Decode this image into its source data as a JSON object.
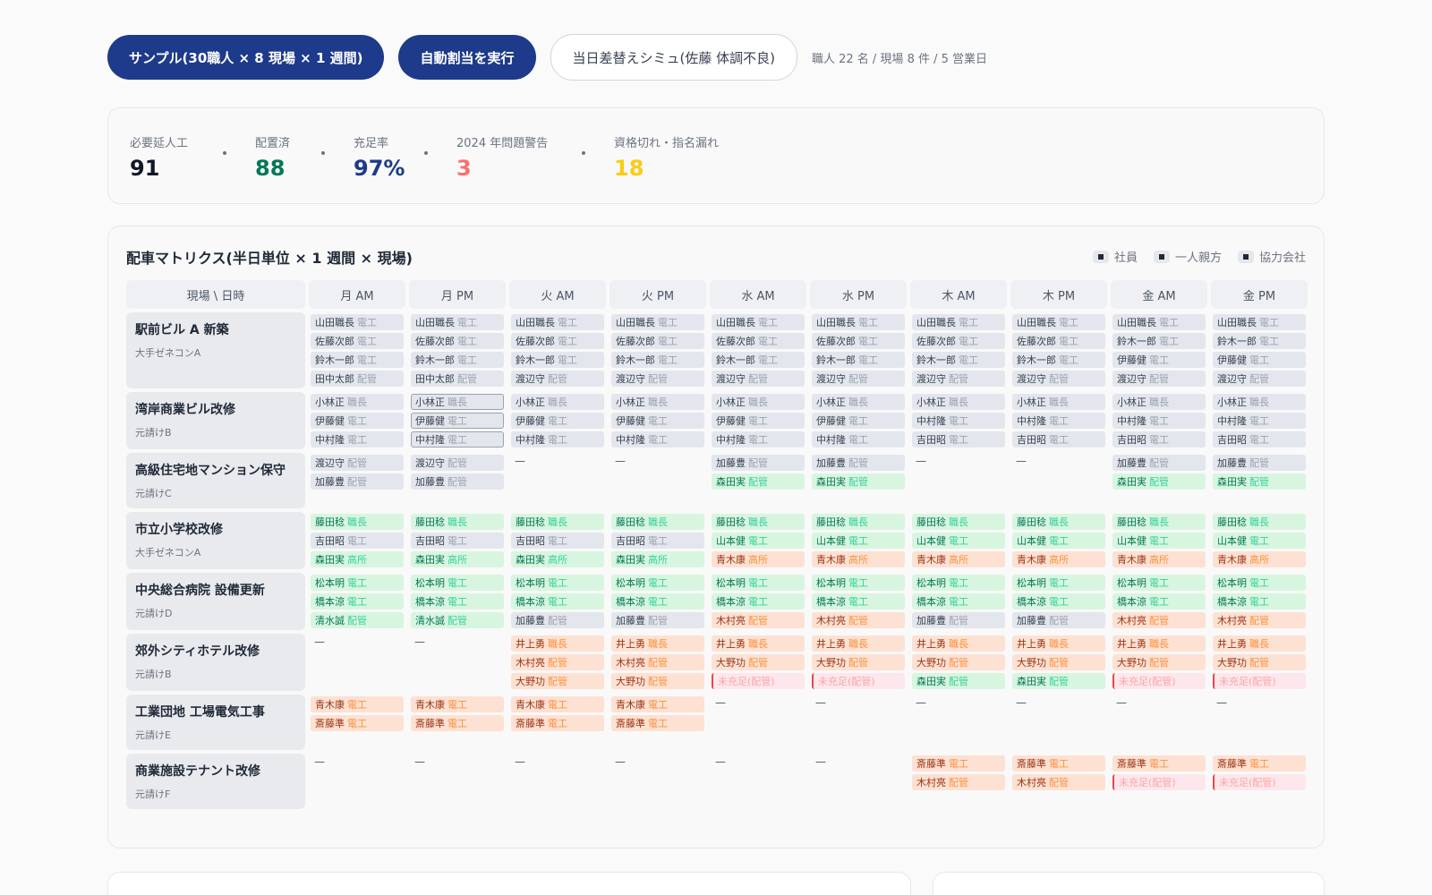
{
  "toolbar": {
    "sample_label": "サンプル(30職人 × 8 現場 × 1 週間)",
    "auto_assign_label": "自動割当を実行",
    "swap_sim_label": "当日差替えシミュ(佐藤 体調不良)",
    "meta": "職人 22 名 / 現場 8 件 / 5 営業日"
  },
  "kpis": [
    {
      "label": "必要延人工",
      "value": "91",
      "color": "#111827"
    },
    {
      "label": "配置済",
      "value": "88",
      "color": "#047857"
    },
    {
      "label": "充足率",
      "value": "97%",
      "color": "#1e3a8a"
    },
    {
      "label": "2024 年問題警告",
      "value": "3",
      "color": "#f87171"
    },
    {
      "label": "資格切れ・指名漏れ",
      "value": "18",
      "color": "#facc15"
    }
  ],
  "matrix": {
    "title": "配車マトリクス(半日単位 × 1 週間 × 現場)",
    "legend": [
      "社員",
      "一人親方",
      "協力会社"
    ],
    "corner": "現場 \\ 日時",
    "columns": [
      "月 AM",
      "月 PM",
      "火 AM",
      "火 PM",
      "水 AM",
      "水 PM",
      "木 AM",
      "木 PM",
      "金 AM",
      "金 PM"
    ],
    "rows": [
      {
        "site": "駅前ビル A 新築",
        "client": "大手ゼネコンA",
        "cells": [
          [
            [
              "e",
              "山田職長",
              "電工"
            ],
            [
              "e",
              "佐藤次郎",
              "電工"
            ],
            [
              "e",
              "鈴木一郎",
              "電工"
            ],
            [
              "e",
              "田中太郎",
              "配管"
            ]
          ],
          [
            [
              "e",
              "山田職長",
              "電工"
            ],
            [
              "e",
              "佐藤次郎",
              "電工"
            ],
            [
              "e",
              "鈴木一郎",
              "電工"
            ],
            [
              "e",
              "田中太郎",
              "配管"
            ]
          ],
          [
            [
              "e",
              "山田職長",
              "電工"
            ],
            [
              "e",
              "佐藤次郎",
              "電工"
            ],
            [
              "e",
              "鈴木一郎",
              "電工"
            ],
            [
              "e",
              "渡辺守",
              "配管"
            ]
          ],
          [
            [
              "e",
              "山田職長",
              "電工"
            ],
            [
              "e",
              "佐藤次郎",
              "電工"
            ],
            [
              "e",
              "鈴木一郎",
              "電工"
            ],
            [
              "e",
              "渡辺守",
              "配管"
            ]
          ],
          [
            [
              "e",
              "山田職長",
              "電工"
            ],
            [
              "e",
              "佐藤次郎",
              "電工"
            ],
            [
              "e",
              "鈴木一郎",
              "電工"
            ],
            [
              "e",
              "渡辺守",
              "配管"
            ]
          ],
          [
            [
              "e",
              "山田職長",
              "電工"
            ],
            [
              "e",
              "佐藤次郎",
              "電工"
            ],
            [
              "e",
              "鈴木一郎",
              "電工"
            ],
            [
              "e",
              "渡辺守",
              "配管"
            ]
          ],
          [
            [
              "e",
              "山田職長",
              "電工"
            ],
            [
              "e",
              "佐藤次郎",
              "電工"
            ],
            [
              "e",
              "鈴木一郎",
              "電工"
            ],
            [
              "e",
              "渡辺守",
              "配管"
            ]
          ],
          [
            [
              "e",
              "山田職長",
              "電工"
            ],
            [
              "e",
              "佐藤次郎",
              "電工"
            ],
            [
              "e",
              "鈴木一郎",
              "電工"
            ],
            [
              "e",
              "渡辺守",
              "配管"
            ]
          ],
          [
            [
              "e",
              "山田職長",
              "電工"
            ],
            [
              "e",
              "鈴木一郎",
              "電工"
            ],
            [
              "e",
              "伊藤健",
              "電工"
            ],
            [
              "e",
              "渡辺守",
              "配管"
            ]
          ],
          [
            [
              "e",
              "山田職長",
              "電工"
            ],
            [
              "e",
              "鈴木一郎",
              "電工"
            ],
            [
              "e",
              "伊藤健",
              "電工"
            ],
            [
              "e",
              "渡辺守",
              "配管"
            ]
          ]
        ]
      },
      {
        "site": "湾岸商業ビル改修",
        "client": "元請けB",
        "cells": [
          [
            [
              "e",
              "小林正",
              "職長"
            ],
            [
              "e",
              "伊藤健",
              "電工"
            ],
            [
              "e",
              "中村隆",
              "電工"
            ]
          ],
          [
            [
              "h",
              "小林正",
              "職長"
            ],
            [
              "h",
              "伊藤健",
              "電工"
            ],
            [
              "h",
              "中村隆",
              "電工"
            ]
          ],
          [
            [
              "e",
              "小林正",
              "職長"
            ],
            [
              "e",
              "伊藤健",
              "電工"
            ],
            [
              "e",
              "中村隆",
              "電工"
            ]
          ],
          [
            [
              "e",
              "小林正",
              "職長"
            ],
            [
              "e",
              "伊藤健",
              "電工"
            ],
            [
              "e",
              "中村隆",
              "電工"
            ]
          ],
          [
            [
              "e",
              "小林正",
              "職長"
            ],
            [
              "e",
              "伊藤健",
              "電工"
            ],
            [
              "e",
              "中村隆",
              "電工"
            ]
          ],
          [
            [
              "e",
              "小林正",
              "職長"
            ],
            [
              "e",
              "伊藤健",
              "電工"
            ],
            [
              "e",
              "中村隆",
              "電工"
            ]
          ],
          [
            [
              "e",
              "小林正",
              "職長"
            ],
            [
              "e",
              "中村隆",
              "電工"
            ],
            [
              "e",
              "吉田昭",
              "電工"
            ]
          ],
          [
            [
              "e",
              "小林正",
              "職長"
            ],
            [
              "e",
              "中村隆",
              "電工"
            ],
            [
              "e",
              "吉田昭",
              "電工"
            ]
          ],
          [
            [
              "e",
              "小林正",
              "職長"
            ],
            [
              "e",
              "中村隆",
              "電工"
            ],
            [
              "e",
              "吉田昭",
              "電工"
            ]
          ],
          [
            [
              "e",
              "小林正",
              "職長"
            ],
            [
              "e",
              "中村隆",
              "電工"
            ],
            [
              "e",
              "吉田昭",
              "電工"
            ]
          ]
        ]
      },
      {
        "site": "高級住宅地マンション保守",
        "client": "元請けC",
        "cells": [
          [
            [
              "e",
              "渡辺守",
              "配管"
            ],
            [
              "e",
              "加藤豊",
              "配管"
            ]
          ],
          [
            [
              "e",
              "渡辺守",
              "配管"
            ],
            [
              "e",
              "加藤豊",
              "配管"
            ]
          ],
          [],
          [],
          [
            [
              "e",
              "加藤豊",
              "配管"
            ],
            [
              "g",
              "森田実",
              "配管"
            ]
          ],
          [
            [
              "e",
              "加藤豊",
              "配管"
            ],
            [
              "g",
              "森田実",
              "配管"
            ]
          ],
          [],
          [],
          [
            [
              "e",
              "加藤豊",
              "配管"
            ],
            [
              "g",
              "森田実",
              "配管"
            ]
          ],
          [
            [
              "e",
              "加藤豊",
              "配管"
            ],
            [
              "g",
              "森田実",
              "配管"
            ]
          ]
        ]
      },
      {
        "site": "市立小学校改修",
        "client": "大手ゼネコンA",
        "cells": [
          [
            [
              "g",
              "藤田稔",
              "職長"
            ],
            [
              "e",
              "吉田昭",
              "電工"
            ],
            [
              "g",
              "森田実",
              "高所"
            ]
          ],
          [
            [
              "g",
              "藤田稔",
              "職長"
            ],
            [
              "e",
              "吉田昭",
              "電工"
            ],
            [
              "g",
              "森田実",
              "高所"
            ]
          ],
          [
            [
              "g",
              "藤田稔",
              "職長"
            ],
            [
              "e",
              "吉田昭",
              "電工"
            ],
            [
              "g",
              "森田実",
              "高所"
            ]
          ],
          [
            [
              "g",
              "藤田稔",
              "職長"
            ],
            [
              "e",
              "吉田昭",
              "電工"
            ],
            [
              "g",
              "森田実",
              "高所"
            ]
          ],
          [
            [
              "g",
              "藤田稔",
              "職長"
            ],
            [
              "g",
              "山本健",
              "電工"
            ],
            [
              "o",
              "青木康",
              "高所"
            ]
          ],
          [
            [
              "g",
              "藤田稔",
              "職長"
            ],
            [
              "g",
              "山本健",
              "電工"
            ],
            [
              "o",
              "青木康",
              "高所"
            ]
          ],
          [
            [
              "g",
              "藤田稔",
              "職長"
            ],
            [
              "g",
              "山本健",
              "電工"
            ],
            [
              "o",
              "青木康",
              "高所"
            ]
          ],
          [
            [
              "g",
              "藤田稔",
              "職長"
            ],
            [
              "g",
              "山本健",
              "電工"
            ],
            [
              "o",
              "青木康",
              "高所"
            ]
          ],
          [
            [
              "g",
              "藤田稔",
              "職長"
            ],
            [
              "g",
              "山本健",
              "電工"
            ],
            [
              "o",
              "青木康",
              "高所"
            ]
          ],
          [
            [
              "g",
              "藤田稔",
              "職長"
            ],
            [
              "g",
              "山本健",
              "電工"
            ],
            [
              "o",
              "青木康",
              "高所"
            ]
          ]
        ]
      },
      {
        "site": "中央総合病院 設備更新",
        "client": "元請けD",
        "cells": [
          [
            [
              "g",
              "松本明",
              "電工"
            ],
            [
              "g",
              "橋本涼",
              "電工"
            ],
            [
              "g",
              "清水誠",
              "配管"
            ]
          ],
          [
            [
              "g",
              "松本明",
              "電工"
            ],
            [
              "g",
              "橋本涼",
              "電工"
            ],
            [
              "g",
              "清水誠",
              "配管"
            ]
          ],
          [
            [
              "g",
              "松本明",
              "電工"
            ],
            [
              "g",
              "橋本涼",
              "電工"
            ],
            [
              "e",
              "加藤豊",
              "配管"
            ]
          ],
          [
            [
              "g",
              "松本明",
              "電工"
            ],
            [
              "g",
              "橋本涼",
              "電工"
            ],
            [
              "e",
              "加藤豊",
              "配管"
            ]
          ],
          [
            [
              "g",
              "松本明",
              "電工"
            ],
            [
              "g",
              "橋本涼",
              "電工"
            ],
            [
              "o",
              "木村亮",
              "配管"
            ]
          ],
          [
            [
              "g",
              "松本明",
              "電工"
            ],
            [
              "g",
              "橋本涼",
              "電工"
            ],
            [
              "o",
              "木村亮",
              "配管"
            ]
          ],
          [
            [
              "g",
              "松本明",
              "電工"
            ],
            [
              "g",
              "橋本涼",
              "電工"
            ],
            [
              "e",
              "加藤豊",
              "配管"
            ]
          ],
          [
            [
              "g",
              "松本明",
              "電工"
            ],
            [
              "g",
              "橋本涼",
              "電工"
            ],
            [
              "e",
              "加藤豊",
              "配管"
            ]
          ],
          [
            [
              "g",
              "松本明",
              "電工"
            ],
            [
              "g",
              "橋本涼",
              "電工"
            ],
            [
              "o",
              "木村亮",
              "配管"
            ]
          ],
          [
            [
              "g",
              "松本明",
              "電工"
            ],
            [
              "g",
              "橋本涼",
              "電工"
            ],
            [
              "o",
              "木村亮",
              "配管"
            ]
          ]
        ]
      },
      {
        "site": "郊外シティホテル改修",
        "client": "元請けB",
        "cells": [
          [],
          [],
          [
            [
              "o",
              "井上勇",
              "職長"
            ],
            [
              "o",
              "木村亮",
              "配管"
            ],
            [
              "o",
              "大野功",
              "配管"
            ]
          ],
          [
            [
              "o",
              "井上勇",
              "職長"
            ],
            [
              "o",
              "木村亮",
              "配管"
            ],
            [
              "o",
              "大野功",
              "配管"
            ]
          ],
          [
            [
              "o",
              "井上勇",
              "職長"
            ],
            [
              "o",
              "大野功",
              "配管"
            ],
            [
              "s",
              "未充足(配管)",
              ""
            ]
          ],
          [
            [
              "o",
              "井上勇",
              "職長"
            ],
            [
              "o",
              "大野功",
              "配管"
            ],
            [
              "s",
              "未充足(配管)",
              ""
            ]
          ],
          [
            [
              "o",
              "井上勇",
              "職長"
            ],
            [
              "o",
              "大野功",
              "配管"
            ],
            [
              "g",
              "森田実",
              "配管"
            ]
          ],
          [
            [
              "o",
              "井上勇",
              "職長"
            ],
            [
              "o",
              "大野功",
              "配管"
            ],
            [
              "g",
              "森田実",
              "配管"
            ]
          ],
          [
            [
              "o",
              "井上勇",
              "職長"
            ],
            [
              "o",
              "大野功",
              "配管"
            ],
            [
              "s",
              "未充足(配管)",
              ""
            ]
          ],
          [
            [
              "o",
              "井上勇",
              "職長"
            ],
            [
              "o",
              "大野功",
              "配管"
            ],
            [
              "s",
              "未充足(配管)",
              ""
            ]
          ]
        ]
      },
      {
        "site": "工業団地 工場電気工事",
        "client": "元請けE",
        "cells": [
          [
            [
              "o",
              "青木康",
              "電工"
            ],
            [
              "o",
              "斎藤準",
              "電工"
            ]
          ],
          [
            [
              "o",
              "青木康",
              "電工"
            ],
            [
              "o",
              "斎藤準",
              "電工"
            ]
          ],
          [
            [
              "o",
              "青木康",
              "電工"
            ],
            [
              "o",
              "斎藤準",
              "電工"
            ]
          ],
          [
            [
              "o",
              "青木康",
              "電工"
            ],
            [
              "o",
              "斎藤準",
              "電工"
            ]
          ],
          [],
          [],
          [],
          [],
          [],
          []
        ]
      },
      {
        "site": "商業施設テナント改修",
        "client": "元請けF",
        "cells": [
          [],
          [],
          [],
          [],
          [],
          [],
          [
            [
              "o",
              "斎藤準",
              "電工"
            ],
            [
              "o",
              "木村亮",
              "配管"
            ]
          ],
          [
            [
              "o",
              "斎藤準",
              "電工"
            ],
            [
              "o",
              "木村亮",
              "配管"
            ]
          ],
          [
            [
              "o",
              "斎藤準",
              "電工"
            ],
            [
              "s",
              "未充足(配管)",
              ""
            ]
          ],
          [
            [
              "o",
              "斎藤準",
              "電工"
            ],
            [
              "s",
              "未充足(配管)",
              ""
            ]
          ]
        ]
      }
    ],
    "empty_mark": "—"
  }
}
